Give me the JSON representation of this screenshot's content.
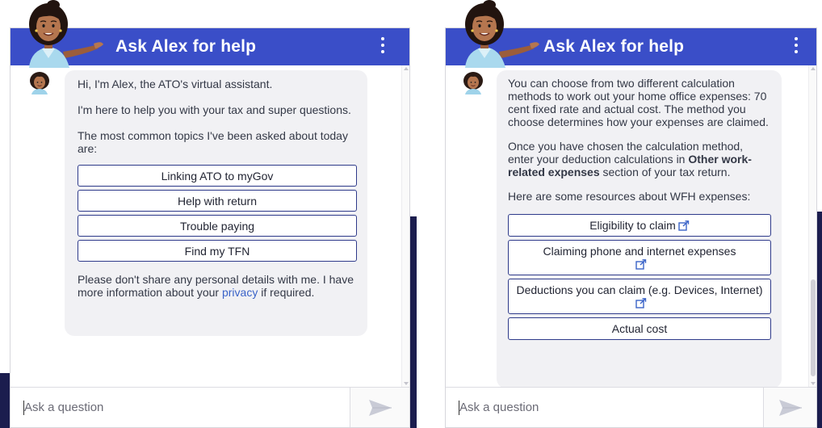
{
  "widget_left": {
    "header": {
      "title": "Ask Alex for help"
    },
    "messages": {
      "intro1": "Hi, I'm Alex, the ATO's virtual assistant.",
      "intro2": "I'm here to help you with your tax and super questions.",
      "intro3": "The most common topics I've been asked about today are:",
      "options": [
        "Linking ATO to myGov",
        "Help with return",
        "Trouble paying",
        "Find my TFN"
      ],
      "privacy_pre": "Please don't share any personal details with me. I have more information about your ",
      "privacy_link": "privacy",
      "privacy_post": " if required."
    },
    "input": {
      "placeholder": "Ask a question"
    }
  },
  "widget_right": {
    "header": {
      "title": "Ask Alex for help"
    },
    "messages": {
      "para1": "You can choose from two different calculation methods to work out your home office expenses: 70 cent fixed rate and actual cost. The method you choose determines how your expenses are claimed.",
      "para2_pre": "Once you have chosen the calculation method, enter your deduction calculations in ",
      "para2_bold": "Other work-related expenses",
      "para2_post": " section of your tax return.",
      "para3": "Here are some resources about WFH expenses:",
      "resources": [
        "Eligibility to claim",
        "Claiming phone and internet expenses",
        "Deductions you can claim (e.g. Devices, Internet)",
        "Actual cost"
      ]
    },
    "input": {
      "placeholder": "Ask a question"
    }
  },
  "colors": {
    "header_blue": "#3a4ec8",
    "bubble_grey": "#f1f1f4",
    "button_border": "#2e3a8a",
    "link_blue": "#3a63c8",
    "background_navy": "#1b1d4e"
  },
  "icons": {
    "menu": "kebab-menu-icon",
    "send": "send-icon",
    "external_link": "external-link-icon",
    "avatar": "alex-avatar"
  }
}
